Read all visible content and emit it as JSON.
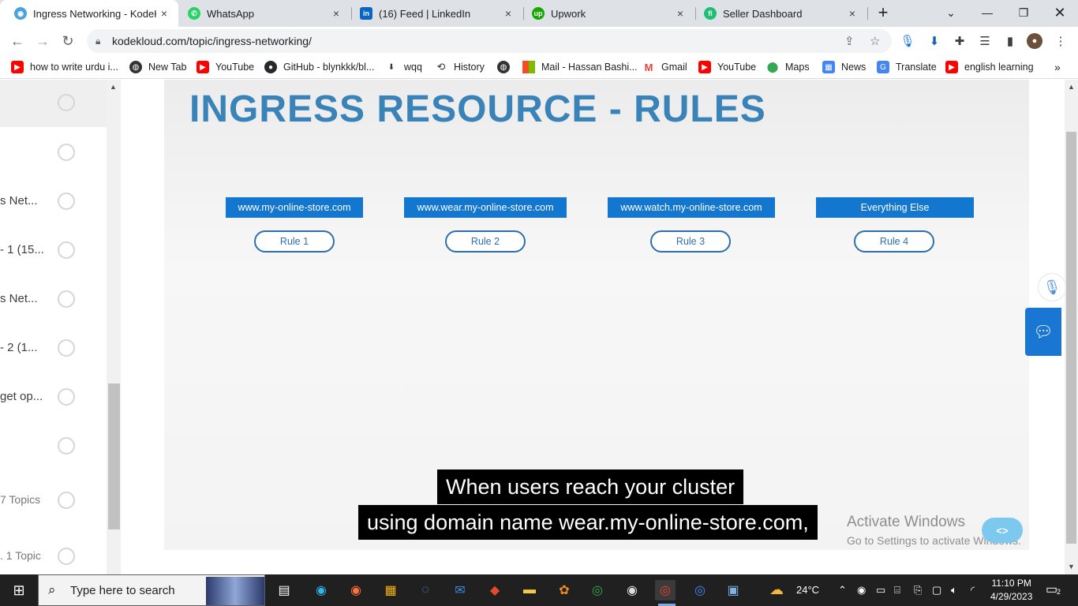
{
  "tabs": [
    {
      "label": "Ingress Networking - KodeKl",
      "icon": "kodekloud-icon",
      "color": "#4aa3df",
      "active": true
    },
    {
      "label": "WhatsApp",
      "icon": "whatsapp-icon",
      "color": "#25d366"
    },
    {
      "label": "(16) Feed | LinkedIn",
      "icon": "linkedin-icon",
      "color": "#0a66c2"
    },
    {
      "label": "Upwork",
      "icon": "upwork-icon",
      "color": "#14a800"
    },
    {
      "label": "Seller Dashboard",
      "icon": "fiverr-icon",
      "color": "#1dbf73"
    }
  ],
  "tab_close": "×",
  "new_tab": "+",
  "address": {
    "url": "kodekloud.com/topic/ingress-networking/"
  },
  "bookmarks": [
    {
      "label": "how to write urdu i...",
      "icon": "youtube-icon",
      "color": "#ff0000"
    },
    {
      "label": "New Tab",
      "icon": "globe-icon",
      "color": "#333333"
    },
    {
      "label": "YouTube",
      "icon": "youtube-icon",
      "color": "#ff0000"
    },
    {
      "label": "GitHub - blynkkk/bl...",
      "icon": "github-icon",
      "color": "#24292e"
    },
    {
      "label": "wqq",
      "icon": "download-icon",
      "color": "#333333"
    },
    {
      "label": "History",
      "icon": "history-icon",
      "color": "#333333"
    },
    {
      "label": "",
      "icon": "globe-icon",
      "color": "#333333"
    },
    {
      "label": "Mail - Hassan Bashi...",
      "icon": "microsoft-icon",
      "color": "#f25022"
    },
    {
      "label": "Gmail",
      "icon": "gmail-icon",
      "color": "#ea4335"
    },
    {
      "label": "YouTube",
      "icon": "youtube-icon",
      "color": "#ff0000"
    },
    {
      "label": "Maps",
      "icon": "maps-icon",
      "color": "#34a853"
    },
    {
      "label": "News",
      "icon": "news-icon",
      "color": "#4285f4"
    },
    {
      "label": "Translate",
      "icon": "translate-icon",
      "color": "#4285f4"
    },
    {
      "label": "english learning",
      "icon": "youtube-icon",
      "color": "#ff0000"
    }
  ],
  "sidebar": {
    "lessons": [
      {
        "label": ""
      },
      {
        "label": ""
      },
      {
        "label": "s Net..."
      },
      {
        "label": "- 1 (15..."
      },
      {
        "label": "s Net..."
      },
      {
        "label": "- 2 (1..."
      },
      {
        "label": "get op..."
      },
      {
        "label": ""
      },
      {
        "label": "7 Topics"
      },
      {
        "label": ".  1 Topic"
      }
    ]
  },
  "slide": {
    "title": "INGRESS RESOURCE - RULES",
    "hosts": [
      "www.my-online-store.com",
      "www.wear.my-online-store.com",
      "www.watch.my-online-store.com",
      "Everything Else"
    ],
    "rules": [
      "Rule 1",
      "Rule 2",
      "Rule 3",
      "Rule 4"
    ],
    "caption": [
      "When users reach your cluster",
      "using domain name wear.my-online-store.com,"
    ]
  },
  "watermark": {
    "line1": "Activate Windows",
    "line2": "Go to Settings to activate Windows."
  },
  "taskbar": {
    "search_placeholder": "Type here to search",
    "weather": "24°C",
    "time": "11:10 PM",
    "date": "4/29/2023",
    "notifications": "2"
  }
}
